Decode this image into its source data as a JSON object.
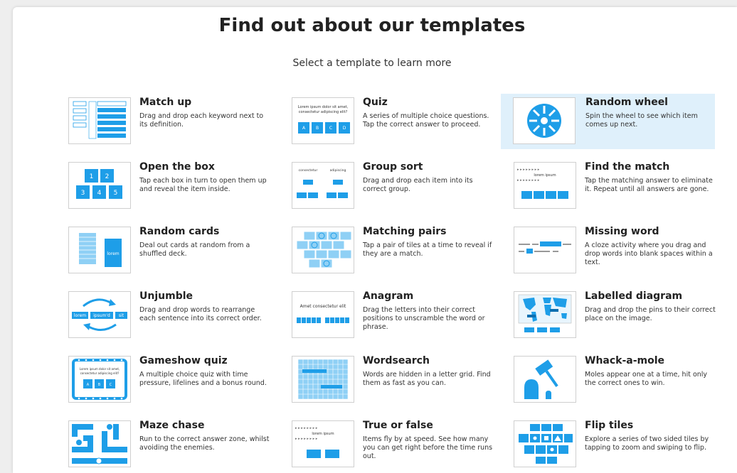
{
  "heading": "Find out about our templates",
  "subheading": "Select a template to learn more",
  "accent": "#1e9ee8",
  "highlight": "#dff0fb",
  "templates": [
    {
      "title": "Match up",
      "desc": "Drag and drop each keyword next to its definition.",
      "icon": "match-up-thumbnail"
    },
    {
      "title": "Quiz",
      "desc": "A series of multiple choice questions. Tap the correct answer to proceed.",
      "icon": "quiz-thumbnail"
    },
    {
      "title": "Random wheel",
      "desc": "Spin the wheel to see which item comes up next.",
      "icon": "random-wheel-thumbnail"
    },
    {
      "title": "Open the box",
      "desc": "Tap each box in turn to open them up and reveal the item inside.",
      "icon": "open-the-box-thumbnail"
    },
    {
      "title": "Group sort",
      "desc": "Drag and drop each item into its correct group.",
      "icon": "group-sort-thumbnail"
    },
    {
      "title": "Find the match",
      "desc": "Tap the matching answer to eliminate it. Repeat until all answers are gone.",
      "icon": "find-the-match-thumbnail"
    },
    {
      "title": "Random cards",
      "desc": "Deal out cards at random from a shuffled deck.",
      "icon": "random-cards-thumbnail"
    },
    {
      "title": "Matching pairs",
      "desc": "Tap a pair of tiles at a time to reveal if they are a match.",
      "icon": "matching-pairs-thumbnail"
    },
    {
      "title": "Missing word",
      "desc": "A cloze activity where you drag and drop words into blank spaces within a text.",
      "icon": "missing-word-thumbnail"
    },
    {
      "title": "Unjumble",
      "desc": "Drag and drop words to rearrange each sentence into its correct order.",
      "icon": "unjumble-thumbnail"
    },
    {
      "title": "Anagram",
      "desc": "Drag the letters into their correct positions to unscramble the word or phrase.",
      "icon": "anagram-thumbnail"
    },
    {
      "title": "Labelled diagram",
      "desc": "Drag and drop the pins to their correct place on the image.",
      "icon": "labelled-diagram-thumbnail"
    },
    {
      "title": "Gameshow quiz",
      "desc": "A multiple choice quiz with time pressure, lifelines and a bonus round.",
      "icon": "gameshow-quiz-thumbnail"
    },
    {
      "title": "Wordsearch",
      "desc": "Words are hidden in a letter grid. Find them as fast as you can.",
      "icon": "wordsearch-thumbnail"
    },
    {
      "title": "Whack-a-mole",
      "desc": "Moles appear one at a time, hit only the correct ones to win.",
      "icon": "whack-a-mole-thumbnail"
    },
    {
      "title": "Maze chase",
      "desc": "Run to the correct answer zone, whilst avoiding the enemies.",
      "icon": "maze-chase-thumbnail"
    },
    {
      "title": "True or false",
      "desc": "Items fly by at speed. See how many you can get right before the time runs out.",
      "icon": "true-or-false-thumbnail"
    },
    {
      "title": "Flip tiles",
      "desc": "Explore a series of two sided tiles by tapping to zoom and swiping to flip.",
      "icon": "flip-tiles-thumbnail"
    }
  ],
  "thumbnail_text": {
    "quiz_question": [
      "Lorem ipsum dolor sit amet,",
      "consectetur adipiscing elit?"
    ],
    "quiz_letters": [
      "A",
      "B",
      "C",
      "D"
    ],
    "box_numbers": [
      "1",
      "2",
      "3",
      "4",
      "5"
    ],
    "group_labels": [
      "consectetur",
      "adipiscing"
    ],
    "find_match_word": "lorem ipsum",
    "random_card_word": "lorem",
    "unjumble_words": [
      "lorem",
      "ipsum'd",
      "sit"
    ],
    "anagram_phrase": "Amet consectetur elit",
    "gameshow_question": [
      "Lorem ipsum dolor sit amet,",
      "consectetur adipiscing elit?"
    ],
    "gameshow_letters": [
      "A",
      "B",
      "C"
    ],
    "true_false_word": "lorem ipsum"
  }
}
